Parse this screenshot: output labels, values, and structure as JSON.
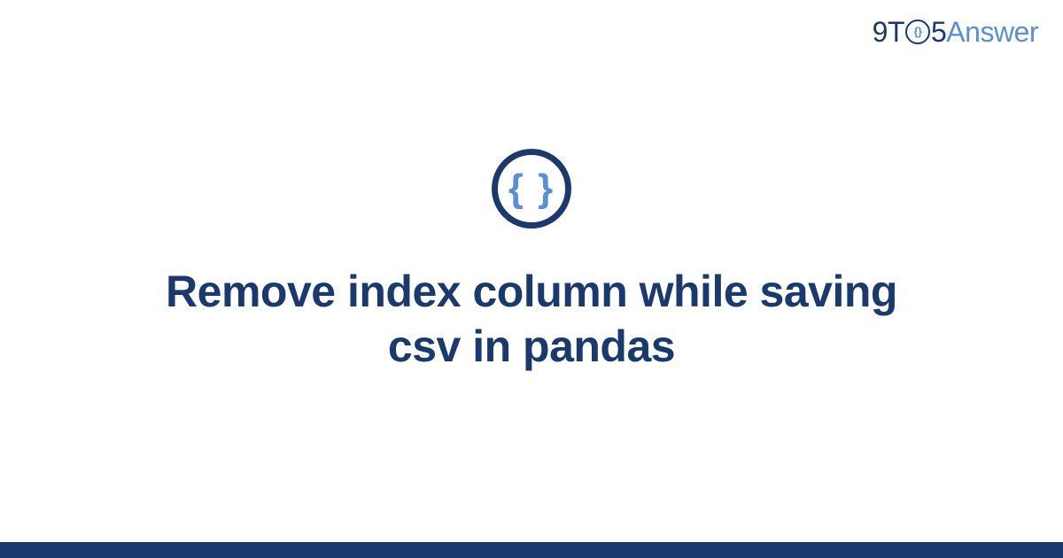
{
  "logo": {
    "part1": "9T",
    "circle_inner": "{}",
    "part2": "5",
    "part3": "Answer"
  },
  "icon": {
    "braces": "{ }"
  },
  "title": "Remove index column while saving csv in pandas",
  "colors": {
    "primary": "#1a3a6e",
    "accent": "#5a8fd4"
  }
}
